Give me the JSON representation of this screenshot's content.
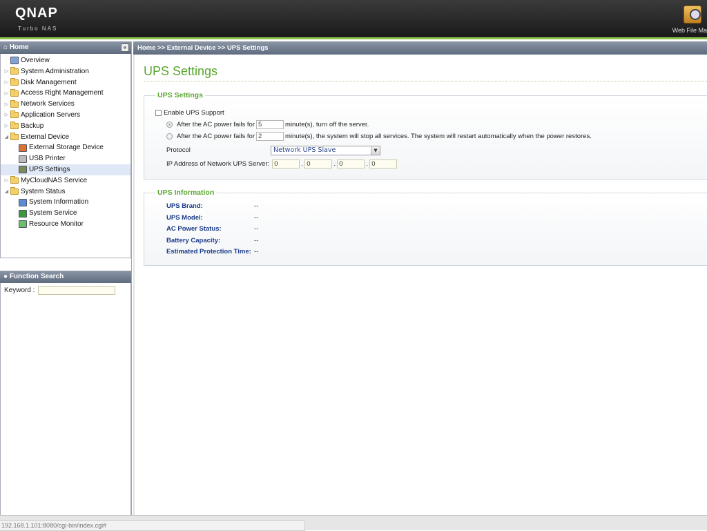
{
  "header": {
    "logo": "QNAP",
    "subtitle": "Turbo NAS",
    "web_file_manager": "Web File Ma"
  },
  "sidebar": {
    "home_label": "Home",
    "items": [
      {
        "label": "Overview",
        "level": 0,
        "icon": "overview-icon"
      },
      {
        "label": "System Administration",
        "level": 0,
        "icon": "folder-icon",
        "expander": "collapsed"
      },
      {
        "label": "Disk Management",
        "level": 0,
        "icon": "folder-icon",
        "expander": "collapsed"
      },
      {
        "label": "Access Right Management",
        "level": 0,
        "icon": "folder-icon",
        "expander": "collapsed"
      },
      {
        "label": "Network Services",
        "level": 0,
        "icon": "folder-icon",
        "expander": "collapsed"
      },
      {
        "label": "Application Servers",
        "level": 0,
        "icon": "folder-icon",
        "expander": "collapsed"
      },
      {
        "label": "Backup",
        "level": 0,
        "icon": "folder-icon",
        "expander": "collapsed"
      },
      {
        "label": "External Device",
        "level": 0,
        "icon": "folder-open-icon",
        "expander": "expanded"
      },
      {
        "label": "External Storage Device",
        "level": 1,
        "icon": "storage-device-icon"
      },
      {
        "label": "USB Printer",
        "level": 1,
        "icon": "printer-icon"
      },
      {
        "label": "UPS Settings",
        "level": 1,
        "icon": "ups-icon",
        "selected": true
      },
      {
        "label": "MyCloudNAS Service",
        "level": 0,
        "icon": "folder-icon",
        "expander": "collapsed"
      },
      {
        "label": "System Status",
        "level": 0,
        "icon": "folder-open-icon",
        "expander": "expanded"
      },
      {
        "label": "System Information",
        "level": 1,
        "icon": "system-info-icon"
      },
      {
        "label": "System Service",
        "level": 1,
        "icon": "system-service-icon"
      },
      {
        "label": "Resource Monitor",
        "level": 1,
        "icon": "resource-monitor-icon"
      }
    ],
    "function_search": {
      "title": "Function Search",
      "keyword_label": "Keyword :",
      "keyword_value": ""
    }
  },
  "breadcrumb": "Home >> External Device >> UPS Settings",
  "main": {
    "title": "UPS Settings",
    "settings": {
      "legend": "UPS Settings",
      "enable_label": "Enable UPS Support",
      "enable_checked": false,
      "opt1_prefix": "After the AC power fails for",
      "opt1_value": "5",
      "opt1_suffix": "minute(s), turn off the server.",
      "opt2_prefix": "After the AC power fails for",
      "opt2_value": "2",
      "opt2_suffix": "minute(s), the system will stop all services. The system will restart automatically when the power restores.",
      "protocol_label": "Protocol",
      "protocol_value": "Network UPS Slave",
      "ip_label": "IP Address of Network UPS Server:",
      "ip": [
        "0",
        "0",
        "0",
        "0"
      ]
    },
    "info": {
      "legend": "UPS Information",
      "rows": [
        {
          "label": "UPS Brand:",
          "value": "--"
        },
        {
          "label": "UPS Model:",
          "value": "--"
        },
        {
          "label": "AC Power Status:",
          "value": "--"
        },
        {
          "label": "Battery Capacity:",
          "value": "--"
        },
        {
          "label": "Estimated Protection Time:",
          "value": "--"
        }
      ]
    }
  },
  "statusbar": {
    "url": "192.168.1.101:8080/cgi-bin/index.cgi#"
  },
  "colors": {
    "accent_green": "#5aa52e",
    "header_bar": "#5e6b7e",
    "info_label_blue": "#1b3a8a"
  }
}
